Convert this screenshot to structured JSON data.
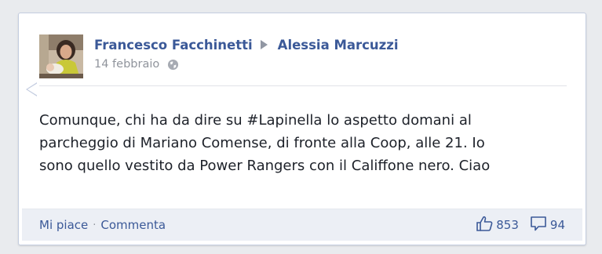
{
  "post": {
    "author": "Francesco Facchinetti",
    "recipient": "Alessia Marcuzzi",
    "date": "14 febbraio",
    "privacy_icon": "globe-icon",
    "text": "Comunque, chi ha da dire su #Lapinella lo aspetto domani al\nparcheggio di Mariano Comense, di fronte alla Coop, alle 21. Io\nsono quello vestito da Power Rangers con il Califfone nero. Ciao"
  },
  "actions": {
    "like_label": "Mi piace",
    "separator": "·",
    "comment_label": "Commenta"
  },
  "stats": {
    "likes_icon": "thumbs-up-icon",
    "likes": "853",
    "comments_icon": "comment-bubble-icon",
    "comments": "94"
  },
  "colors": {
    "link": "#3b5998",
    "background": "#e9ebee",
    "footer": "#eceff5"
  }
}
